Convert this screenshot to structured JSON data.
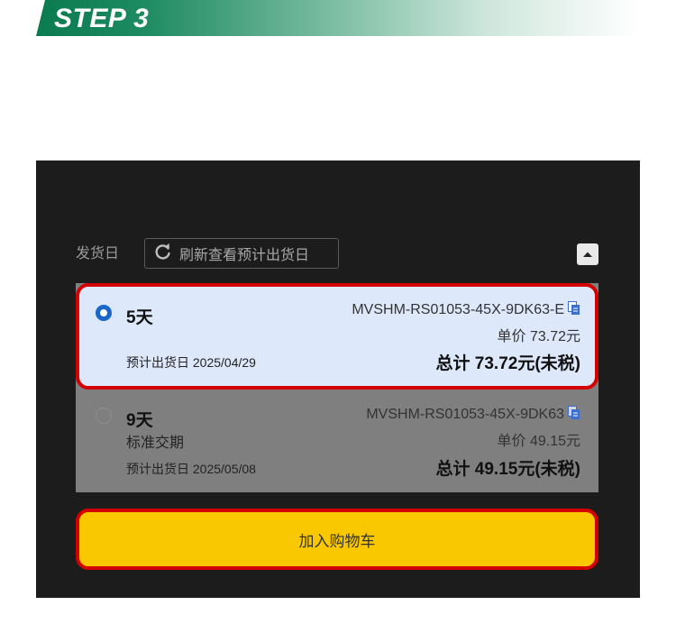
{
  "banner": {
    "step_label": "STEP 3"
  },
  "shipping": {
    "label": "发货日",
    "refresh_label": "刷新查看预计出货日"
  },
  "options": [
    {
      "selected": true,
      "days": "5天",
      "part_number": "MVSHM-RS01053-45X-9DK63-E",
      "unit_price": "单价 73.72元",
      "ship_date": "预计出货日 2025/04/29",
      "total": "总计 73.72元(未税)"
    },
    {
      "selected": false,
      "days": "9天",
      "subtitle": "标准交期",
      "part_number": "MVSHM-RS01053-45X-9DK63",
      "unit_price": "单价 49.15元",
      "ship_date": "预计出货日 2025/05/08",
      "total": "总计 49.15元(未税)"
    }
  ],
  "cart": {
    "label": "加入购物车"
  },
  "colors": {
    "accent_green": "#0a7a4f",
    "highlight_red": "#d40000",
    "selected_bg": "#dde8fb",
    "radio_blue": "#1a66c9",
    "cart_yellow": "#fac800",
    "panel_bg": "#1c1c1c"
  },
  "icons": {
    "refresh": "refresh-icon",
    "collapse": "caret-up-icon",
    "copy": "copy-icon"
  }
}
